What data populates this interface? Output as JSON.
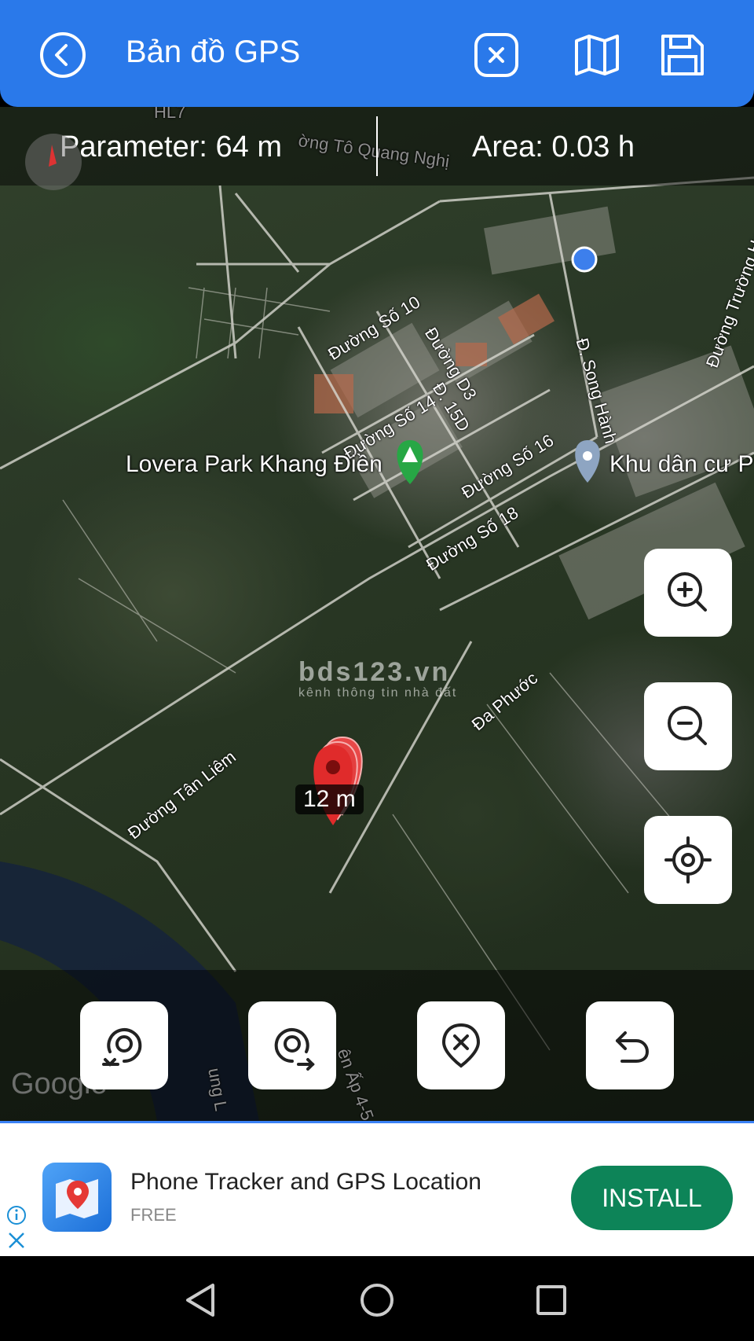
{
  "header": {
    "title": "Bản đồ GPS",
    "back_icon": "back-circle-icon",
    "actions": [
      "clear-box-icon",
      "map-icon",
      "save-icon"
    ],
    "color": "#2a79ea"
  },
  "stats": {
    "parameter": "Parameter: 64 m",
    "area": "Area: 0.03 h"
  },
  "map": {
    "places": {
      "park": "Lovera Park Khang Điền",
      "residential": "Khu dân cư P"
    },
    "streets": {
      "hl7": "HL7",
      "quang_nghi": "ờng Tô Quang Nghị",
      "so10": "Đường Số 10",
      "d3": "Đường D3",
      "so14": "Đường Số 14",
      "d15d": "Đ. 15D",
      "so16": "Đường Số 16",
      "so18": "Đường Số 18",
      "song_hanh": "Đ. Song Hành",
      "truong_hoc": "Đường Trường Học",
      "da_phuoc": "Đa Phước",
      "tan_liem": "Đường Tân Liêm",
      "ap45": "ên Ấp 4-5",
      "tung": "ung L"
    },
    "watermark": {
      "main": "bds123.vn",
      "sub": "kênh thông tin nhà đất"
    },
    "pin_label": "12 m",
    "google": "Google",
    "side_buttons": [
      "zoom-in-icon",
      "zoom-out-icon",
      "my-location-icon"
    ],
    "tools": [
      "rotate-left-location-icon",
      "rotate-right-location-icon",
      "remove-pin-icon",
      "undo-icon"
    ]
  },
  "ad": {
    "title": "Phone Tracker and GPS Location",
    "subtitle": "FREE",
    "install": "INSTALL",
    "install_color": "#0d8458"
  },
  "navbar": [
    "back-triangle-icon",
    "home-circle-icon",
    "recents-square-icon"
  ]
}
